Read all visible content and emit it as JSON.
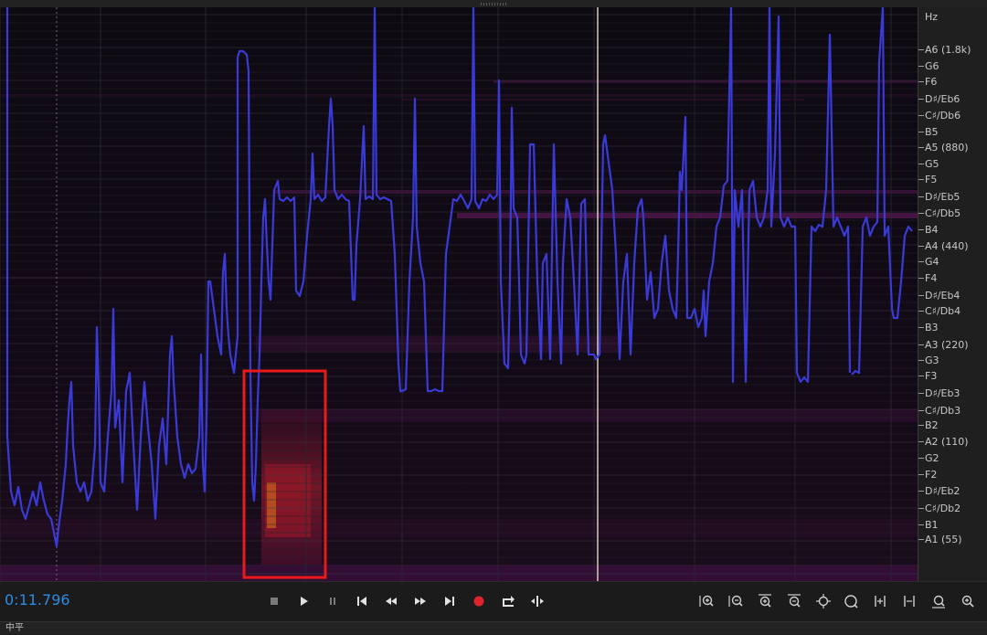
{
  "playback": {
    "current_time": "0:11.796"
  },
  "frequency_axis": {
    "unit_label": "Hz",
    "notes": [
      "A6 (1.8k)",
      "G6",
      "F6",
      "D♯/Eb6",
      "C♯/Db6",
      "B5",
      "A5 (880)",
      "G5",
      "F5",
      "D♯/Eb5",
      "C♯/Db5",
      "B4",
      "A4 (440)",
      "G4",
      "F4",
      "D♯/Eb4",
      "C♯/Db4",
      "B3",
      "A3 (220)",
      "G3",
      "F3",
      "D♯/Eb3",
      "C♯/Db3",
      "B2",
      "A2 (110)",
      "G2",
      "F2",
      "D♯/Eb2",
      "C♯/Db2",
      "B1",
      "A1 (55)"
    ]
  },
  "transport": {
    "buttons": [
      "stop",
      "play",
      "pause",
      "go-to-start",
      "rewind",
      "fast-forward",
      "go-to-end",
      "record",
      "loop",
      "skip-selection"
    ]
  },
  "zoom_tools": [
    "zoom-in-amplitude",
    "zoom-out-amplitude",
    "zoom-in-time",
    "zoom-out-time",
    "zoom-to-selection",
    "zoom-in-frequency",
    "zoom-out-frequency",
    "zoom-full",
    "zoom-in-point"
  ],
  "status": {
    "label": "中平"
  },
  "colors": {
    "pitch_line": "#3a3ad8",
    "selection_box": "#e81a1a",
    "time_readout": "#2e8ce6",
    "record_button": "#e0242c"
  }
}
